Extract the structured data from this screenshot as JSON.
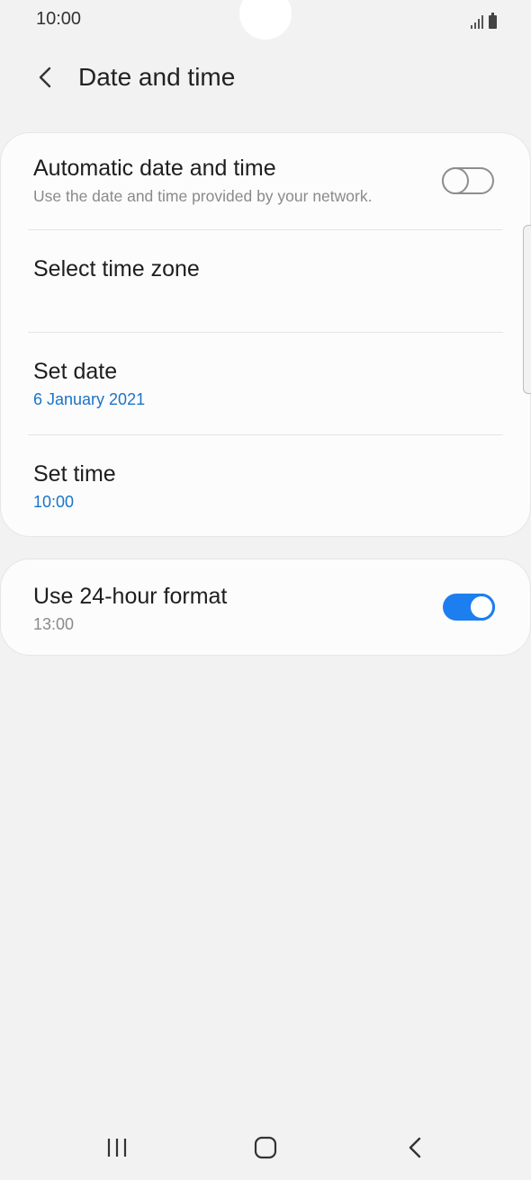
{
  "status_bar": {
    "time": "10:00"
  },
  "header": {
    "title": "Date and time",
    "back_icon": "chevron-left-icon"
  },
  "settings_group_1": [
    {
      "title": "Automatic date and time",
      "subtitle": "Use the date and time provided by your network.",
      "toggle": "off"
    },
    {
      "title": "Select time zone",
      "subtitle": ""
    },
    {
      "title": "Set date",
      "subtitle": "6 January 2021"
    },
    {
      "title": "Set time",
      "subtitle": "10:00"
    }
  ],
  "settings_group_2": [
    {
      "title": "Use 24-hour format",
      "subtitle": "13:00",
      "toggle": "on"
    }
  ],
  "colors": {
    "accent": "#1d7ef0",
    "value_text": "#1a73c8",
    "background": "#f2f2f2",
    "card": "#fcfcfc"
  },
  "nav_bar": {
    "recent_icon": "recent-apps-icon",
    "home_icon": "home-icon",
    "back_icon": "back-icon"
  }
}
